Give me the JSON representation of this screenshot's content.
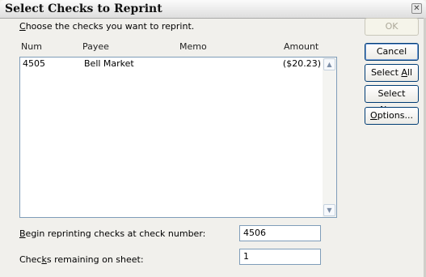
{
  "window": {
    "title": "Select Checks to Reprint"
  },
  "instruction": {
    "mnemonic": "C",
    "rest": "hoose the checks you want to reprint."
  },
  "columns": {
    "num": "Num",
    "payee": "Payee",
    "memo": "Memo",
    "amount": "Amount"
  },
  "rows": [
    {
      "num": "4505",
      "payee": "Bell Market",
      "memo": "",
      "amount": "($20.23)"
    }
  ],
  "buttons": {
    "ok": "OK",
    "cancel": "Cancel",
    "select_all": {
      "pre": "Select ",
      "mn": "A",
      "post": "ll"
    },
    "select_none": {
      "pre": "Select ",
      "mn": "N",
      "post": "one"
    },
    "options": {
      "pre": "",
      "mn": "O",
      "post": "ptions..."
    }
  },
  "begin": {
    "mnemonic": "B",
    "rest": "egin reprinting checks at check number:",
    "value": "4506"
  },
  "remaining": {
    "pre": "Chec",
    "mnemonic": "k",
    "rest": "s remaining on sheet:",
    "value": "1"
  },
  "icons": {
    "close": "close-icon",
    "scroll_up": "chevron-up-icon",
    "scroll_down": "chevron-down-icon"
  }
}
